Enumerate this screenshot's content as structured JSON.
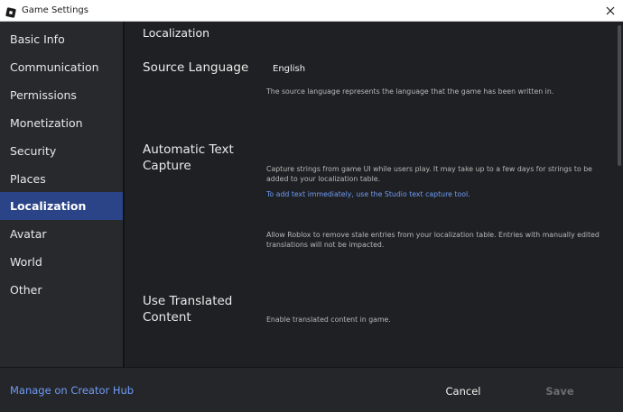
{
  "window": {
    "title": "Game Settings",
    "logo_icon": "roblox-studio-icon",
    "close_icon": "close-icon"
  },
  "sidebar": {
    "items": [
      {
        "label": "Basic Info"
      },
      {
        "label": "Communication"
      },
      {
        "label": "Permissions"
      },
      {
        "label": "Monetization"
      },
      {
        "label": "Security"
      },
      {
        "label": "Places"
      },
      {
        "label": "Localization",
        "active": true
      },
      {
        "label": "Avatar"
      },
      {
        "label": "World"
      },
      {
        "label": "Other"
      }
    ]
  },
  "main": {
    "heading": "Localization",
    "source_language": {
      "title": "Source Language",
      "value": "English",
      "description": "The source language represents the language that the game has been written in."
    },
    "auto_capture": {
      "title": "Automatic Text Capture",
      "description": "Capture strings from game UI while users play. It may take up to a few days for strings to be added to your localization table.",
      "link": "To add text immediately, use the Studio text capture tool.",
      "cleanup_description": "Allow Roblox to remove stale entries from your localization table. Entries with manually edited translations will not be impacted."
    },
    "translated_content": {
      "title": "Use Translated Content",
      "description": "Enable translated content in game."
    }
  },
  "footer": {
    "creator_hub_link": "Manage on Creator Hub",
    "cancel_label": "Cancel",
    "save_label": "Save"
  },
  "colors": {
    "accent": "#2a4487",
    "link": "#6f9cf5",
    "background": "#1f2023",
    "sidebar": "#27292d"
  }
}
